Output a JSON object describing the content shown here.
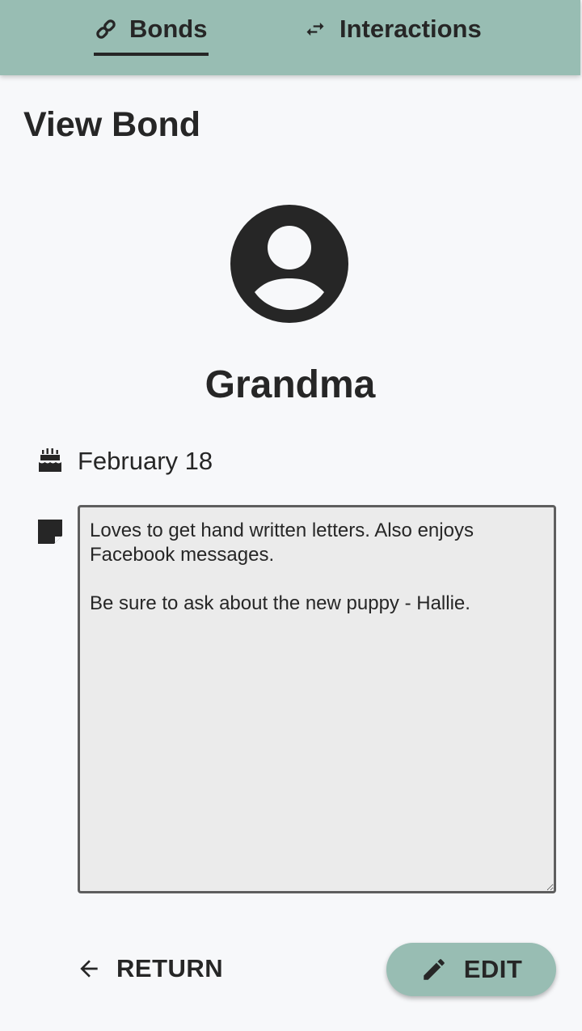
{
  "nav": {
    "tabs": [
      {
        "label": "Bonds",
        "icon": "link-icon",
        "active": true
      },
      {
        "label": "Interactions",
        "icon": "swap-arrows-icon",
        "active": false
      }
    ]
  },
  "page": {
    "title": "View Bond"
  },
  "bond": {
    "avatar_icon": "account-circle-icon",
    "name": "Grandma",
    "birthday_icon": "cake-icon",
    "birthday": "February 18",
    "notes_icon": "sticky-note-icon",
    "notes": "Loves to get hand written letters. Also enjoys Facebook messages.\n\nBe sure to ask about the new puppy - Hallie."
  },
  "actions": {
    "return_label": "RETURN",
    "return_icon": "arrow-left-icon",
    "edit_label": "EDIT",
    "edit_icon": "pencil-icon"
  },
  "colors": {
    "accent": "#98bdb3",
    "background": "#f7f8fa",
    "text": "#262626",
    "notes_background": "#ebebeb"
  }
}
